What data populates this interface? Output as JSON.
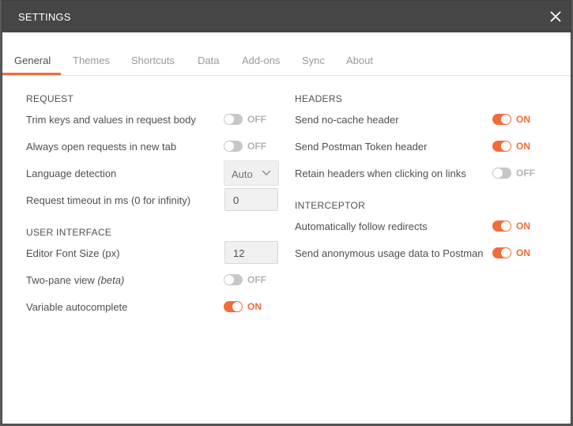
{
  "title": "SETTINGS",
  "tabs": [
    {
      "label": "General",
      "active": true
    },
    {
      "label": "Themes"
    },
    {
      "label": "Shortcuts"
    },
    {
      "label": "Data"
    },
    {
      "label": "Add-ons"
    },
    {
      "label": "Sync"
    },
    {
      "label": "About"
    }
  ],
  "request": {
    "title": "REQUEST",
    "trim": {
      "label": "Trim keys and values in request body",
      "state": "OFF"
    },
    "always_open": {
      "label": "Always open requests in new tab",
      "state": "OFF"
    },
    "language": {
      "label": "Language detection",
      "value": "Auto"
    },
    "timeout": {
      "label": "Request timeout in ms (0 for infinity)",
      "value": "0"
    }
  },
  "ui": {
    "title": "USER INTERFACE",
    "font_size": {
      "label": "Editor Font Size (px)",
      "value": "12"
    },
    "two_pane": {
      "label": "Two-pane view",
      "label_suffix": "(beta)",
      "state": "OFF"
    },
    "variable_autocomplete": {
      "label": "Variable autocomplete",
      "state": "ON"
    }
  },
  "headers": {
    "title": "HEADERS",
    "no_cache": {
      "label": "Send no-cache header",
      "state": "ON"
    },
    "postman_token": {
      "label": "Send Postman Token header",
      "state": "ON"
    },
    "retain": {
      "label": "Retain headers when clicking on links",
      "state": "OFF"
    }
  },
  "interceptor": {
    "title": "INTERCEPTOR",
    "redirects": {
      "label": "Automatically follow redirects",
      "state": "ON"
    },
    "anonymous": {
      "label": "Send anonymous usage data to Postman",
      "state": "ON"
    }
  },
  "colors": {
    "accent": "#f26b3a",
    "titlebar": "#464646",
    "toggle_off": "#c7c7c7"
  },
  "icons": {
    "close": "close-icon",
    "dropdown": "chevron-down-icon"
  }
}
